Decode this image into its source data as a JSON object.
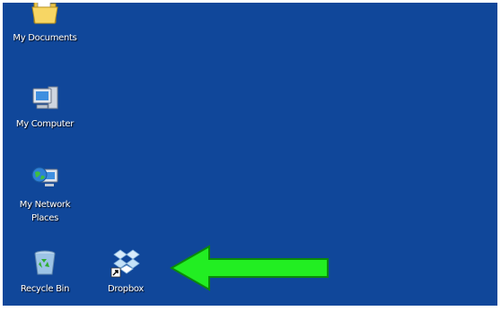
{
  "desktop": {
    "background_color": "#10479a",
    "icons": [
      {
        "label": "My Documents",
        "icon": "folder-documents-icon"
      },
      {
        "label": "My Computer",
        "icon": "computer-icon"
      },
      {
        "label": "My Network\nPlaces",
        "icon": "network-places-icon"
      },
      {
        "label": "Recycle Bin",
        "icon": "recycle-bin-icon"
      },
      {
        "label": "Dropbox",
        "icon": "dropbox-shortcut-icon"
      }
    ],
    "annotation": {
      "icon": "green-arrow-icon",
      "color": "#22ee22",
      "points_to": "Dropbox"
    }
  }
}
